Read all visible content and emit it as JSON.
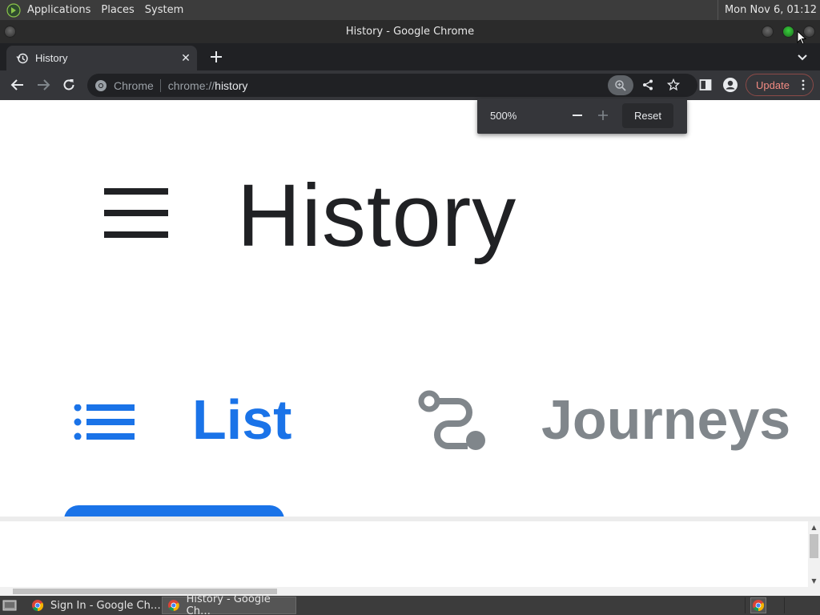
{
  "top_panel": {
    "menus": [
      "Applications",
      "Places",
      "System"
    ],
    "clock": "Mon Nov  6, 01:12"
  },
  "window": {
    "title": "History - Google Chrome"
  },
  "tabstrip": {
    "tabs": [
      {
        "label": "History",
        "icon": "history-icon"
      }
    ]
  },
  "toolbar": {
    "site_chip": "Chrome",
    "url_scheme": "chrome://",
    "url_host": "history",
    "update_label": "Update"
  },
  "zoom_bubble": {
    "level": "500%",
    "reset_label": "Reset"
  },
  "page": {
    "title": "History",
    "tabs": [
      {
        "label": "List",
        "icon": "list-icon",
        "active": true
      },
      {
        "label": "Journeys",
        "icon": "journeys-icon",
        "active": false
      }
    ]
  },
  "taskbar": {
    "tasks": [
      {
        "label": "Sign In - Google Ch…",
        "active": false
      },
      {
        "label": "History - Google Ch…",
        "active": true
      }
    ]
  },
  "colors": {
    "accent": "#1a73e8",
    "inactive_tab_text": "#80868b",
    "update_text": "#f28b82"
  }
}
